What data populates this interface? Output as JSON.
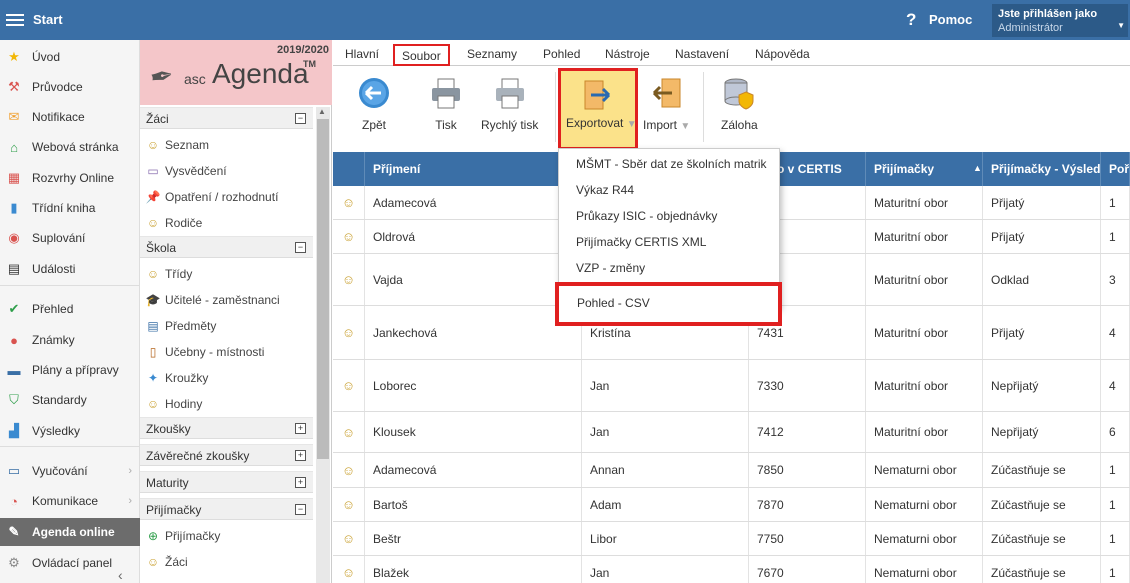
{
  "topbar": {
    "start_label": "Start",
    "help_label": "Pomoc",
    "user_line1": "Jste přihlášen jako",
    "user_line2": "Administrátor"
  },
  "leftnav": [
    {
      "label": "Úvod",
      "icon": "star-icon",
      "glyph": "★",
      "color": "#f2b705"
    },
    {
      "label": "Průvodce",
      "icon": "wizard-icon",
      "glyph": "⚒",
      "color": "#d9534f"
    },
    {
      "label": "Notifikace",
      "icon": "mail-icon",
      "glyph": "✉",
      "color": "#f0a030"
    },
    {
      "label": "Webová stránka",
      "icon": "home-icon",
      "glyph": "⌂",
      "color": "#2e9e4a"
    },
    {
      "label": "Rozvrhy Online",
      "icon": "timetable-icon",
      "glyph": "▦",
      "color": "#d9534f"
    },
    {
      "label": "Třídní kniha",
      "icon": "book-icon",
      "glyph": "▮",
      "color": "#3a8ad0"
    },
    {
      "label": "Suplování",
      "icon": "substitution-icon",
      "glyph": "◉",
      "color": "#d9534f"
    },
    {
      "label": "Události",
      "icon": "calendar-icon",
      "glyph": "▤",
      "color": "#333"
    },
    {
      "label": "Přehled",
      "icon": "check-icon",
      "glyph": "✔",
      "color": "#2e9e4a"
    },
    {
      "label": "Známky",
      "icon": "grades-icon",
      "glyph": "●",
      "color": "#d9534f"
    },
    {
      "label": "Plány a přípravy",
      "icon": "briefcase-icon",
      "glyph": "▬",
      "color": "#3a6fa6"
    },
    {
      "label": "Standardy",
      "icon": "shield-icon",
      "glyph": "⛉",
      "color": "#2e9e4a"
    },
    {
      "label": "Výsledky",
      "icon": "barchart-icon",
      "glyph": "▟",
      "color": "#3a8ad0"
    },
    {
      "label": "Vyučování",
      "icon": "teaching-icon",
      "glyph": "▭",
      "color": "#3a6fa6"
    },
    {
      "label": "Komunikace",
      "icon": "chat-icon",
      "glyph": "◔",
      "color": "#d9534f"
    },
    {
      "label": "Agenda online",
      "icon": "pen-icon",
      "glyph": "✎",
      "color": "#fff"
    },
    {
      "label": "Ovládací panel",
      "icon": "settings-icon",
      "glyph": "⚙",
      "color": "#888"
    }
  ],
  "agenda": {
    "year": "2019/2020",
    "logo_prefix": "asc",
    "logo_name": "Agenda",
    "logo_tm": "TM",
    "sections": [
      {
        "label": "Žáci",
        "toggle": "−",
        "items": [
          {
            "label": "Seznam",
            "glyph": "☺",
            "color": "#c9a030"
          },
          {
            "label": "Vysvědčení",
            "glyph": "▭",
            "color": "#8a6fb0"
          },
          {
            "label": "Opatření / rozhodnutí",
            "glyph": "📌",
            "color": "#d9534f"
          },
          {
            "label": "Rodiče",
            "glyph": "☺",
            "color": "#c9a030"
          }
        ]
      },
      {
        "label": "Škola",
        "toggle": "−",
        "items": [
          {
            "label": "Třídy",
            "glyph": "☺",
            "color": "#c9a030"
          },
          {
            "label": "Učitelé - zaměstnanci",
            "glyph": "🎓",
            "color": "#333"
          },
          {
            "label": "Předměty",
            "glyph": "▤",
            "color": "#3a6fa6"
          },
          {
            "label": "Učebny - místnosti",
            "glyph": "▯",
            "color": "#b5651d"
          },
          {
            "label": "Kroužky",
            "glyph": "✦",
            "color": "#3a8ad0"
          },
          {
            "label": "Hodiny",
            "glyph": "☺",
            "color": "#c9a030"
          }
        ]
      },
      {
        "label": "Zkoušky",
        "toggle": "+",
        "items": []
      },
      {
        "label": "Závěrečné zkoušky",
        "toggle": "+",
        "items": []
      },
      {
        "label": "Maturity",
        "toggle": "+",
        "items": []
      },
      {
        "label": "Přijímačky",
        "toggle": "−",
        "items": [
          {
            "label": "Přijímačky",
            "glyph": "⊕",
            "color": "#2e9e4a"
          },
          {
            "label": "Žáci",
            "glyph": "☺",
            "color": "#c9a030"
          }
        ]
      }
    ]
  },
  "menubar": [
    "Hlavní",
    "Soubor",
    "Seznamy",
    "Pohled",
    "Nástroje",
    "Nastavení",
    "Nápověda"
  ],
  "toolbar": {
    "back": "Zpět",
    "print": "Tisk",
    "quick_print": "Rychlý tisk",
    "export": "Exportovat",
    "import": "Import",
    "backup": "Záloha"
  },
  "export_menu": [
    "MŠMT - Sběr dat ze školních matrik",
    "Výkaz R44",
    "Průkazy ISIC - objednávky",
    "Přijímačky CERTIS XML",
    "VZP - změny",
    "Pohled - CSV"
  ],
  "table": {
    "headers": [
      "Příjmení",
      "",
      "číslo v CERTIS",
      "Přijímačky",
      "Přijímačky - Výsled",
      "Poř"
    ],
    "rows": [
      [
        "Adamecová",
        "",
        "",
        "Maturitní obor",
        "Přijatý",
        "1"
      ],
      [
        "Oldrová",
        "",
        "",
        "Maturitní obor",
        "Přijatý",
        "1"
      ],
      [
        "Vajda",
        "",
        "",
        "Maturitní obor",
        "Odklad",
        "3"
      ],
      [
        "Jankechová",
        "Kristína",
        "7431",
        "Maturitní obor",
        "Přijatý",
        "4"
      ],
      [
        "Loborec",
        "Jan",
        "7330",
        "Maturitní obor",
        "Nepřijatý",
        "4"
      ],
      [
        "Klousek",
        "Jan",
        "7412",
        "Maturitní obor",
        "Nepřijatý",
        "6"
      ],
      [
        "Adamecová",
        "Annan",
        "7850",
        "Nematurni obor",
        "Zúčastňuje se",
        "1"
      ],
      [
        "Bartoš",
        "Adam",
        "7870",
        "Nematurni obor",
        "Zúčastňuje se",
        "1"
      ],
      [
        "Beštr",
        "Libor",
        "7750",
        "Nematurni obor",
        "Zúčastňuje se",
        "1"
      ],
      [
        "Blažek",
        "Jan",
        "7670",
        "Nematurni obor",
        "Zúčastňuje se",
        "1"
      ]
    ]
  }
}
